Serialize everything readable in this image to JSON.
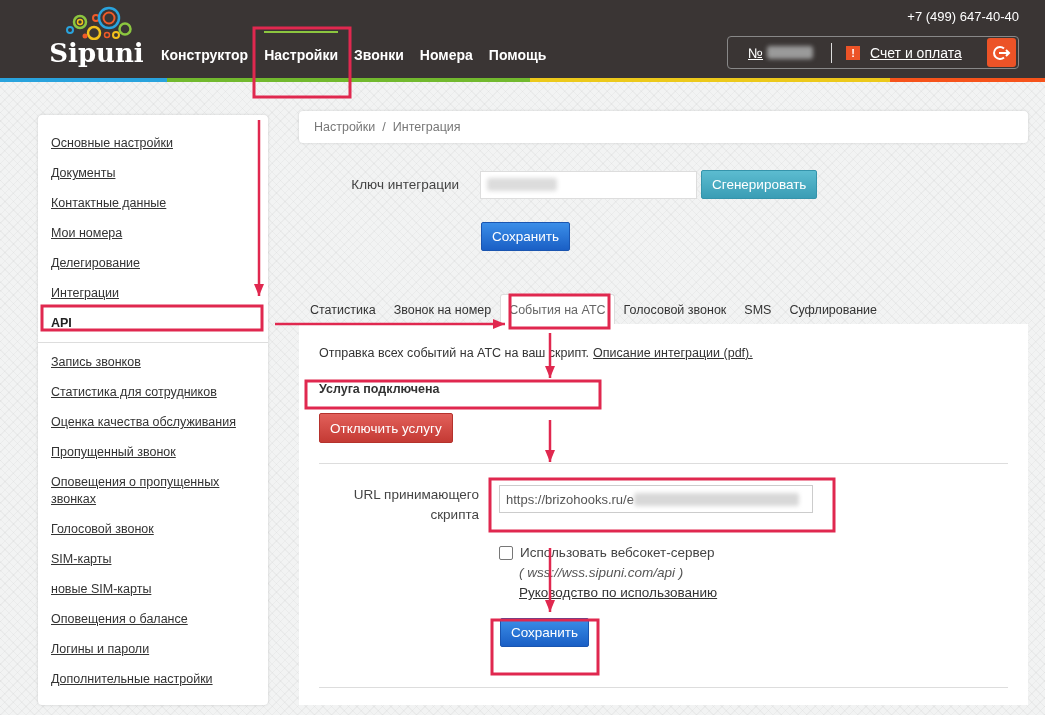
{
  "header": {
    "logo": "Sipuni",
    "phone": "+7 (499) 647-40-40",
    "account_prefix": "№",
    "alert_mark": "!",
    "billing_link": "Счет и оплата",
    "nav": [
      {
        "label": "Конструктор",
        "selected": false
      },
      {
        "label": "Настройки",
        "selected": true
      },
      {
        "label": "Звонки",
        "selected": false
      },
      {
        "label": "Номера",
        "selected": false
      },
      {
        "label": "Помощь",
        "selected": false
      }
    ]
  },
  "sidebar": {
    "groups": [
      [
        {
          "label": "Основные настройки",
          "selected": false
        },
        {
          "label": "Документы",
          "selected": false
        },
        {
          "label": "Контактные данные",
          "selected": false
        },
        {
          "label": "Мои номера",
          "selected": false
        },
        {
          "label": "Делегирование",
          "selected": false
        },
        {
          "label": "Интеграции",
          "selected": false
        },
        {
          "label": "API",
          "selected": true
        }
      ],
      [
        {
          "label": "Запись звонков",
          "selected": false
        },
        {
          "label": "Статистика для сотрудников",
          "selected": false
        },
        {
          "label": "Оценка качества обслуживания",
          "selected": false
        },
        {
          "label": "Пропущенный звонок",
          "selected": false
        },
        {
          "label": "Оповещения о пропущенных звонках",
          "selected": false
        },
        {
          "label": "Голосовой звонок",
          "selected": false
        },
        {
          "label": "SIM-карты",
          "selected": false
        },
        {
          "label": "новые SIM-карты",
          "selected": false
        },
        {
          "label": "Оповещения о балансе",
          "selected": false
        },
        {
          "label": "Логины и пароли",
          "selected": false
        },
        {
          "label": "Дополнительные настройки",
          "selected": false
        }
      ]
    ]
  },
  "breadcrumb": {
    "items": [
      "Настройки",
      "Интеграция"
    ],
    "separator": "/"
  },
  "integration_key": {
    "label": "Ключ интеграции",
    "generate_button": "Сгенерировать",
    "save_button": "Сохранить"
  },
  "tabs": [
    {
      "label": "Статистика",
      "selected": false
    },
    {
      "label": "Звонок на номер",
      "selected": false
    },
    {
      "label": "События на АТС",
      "selected": true
    },
    {
      "label": "Голосовой звонок",
      "selected": false
    },
    {
      "label": "SMS",
      "selected": false
    },
    {
      "label": "Суфлирование",
      "selected": false
    }
  ],
  "panel": {
    "description": "Отправка всех событий на АТС на ваш скрипт.",
    "description_link": "Описание интеграции (pdf).",
    "status": "Услуга подключена",
    "disable_button": "Отключить услугу",
    "url_label": "URL принимающего скрипта",
    "url_value": "https://brizohooks.ru/e",
    "websocket": {
      "label": "Использовать вебсокет-сервер",
      "checked": false,
      "hint": "( wss://wss.sipuni.com/api )",
      "guide_link": "Руководство по использованию"
    },
    "save_button": "Сохранить"
  }
}
